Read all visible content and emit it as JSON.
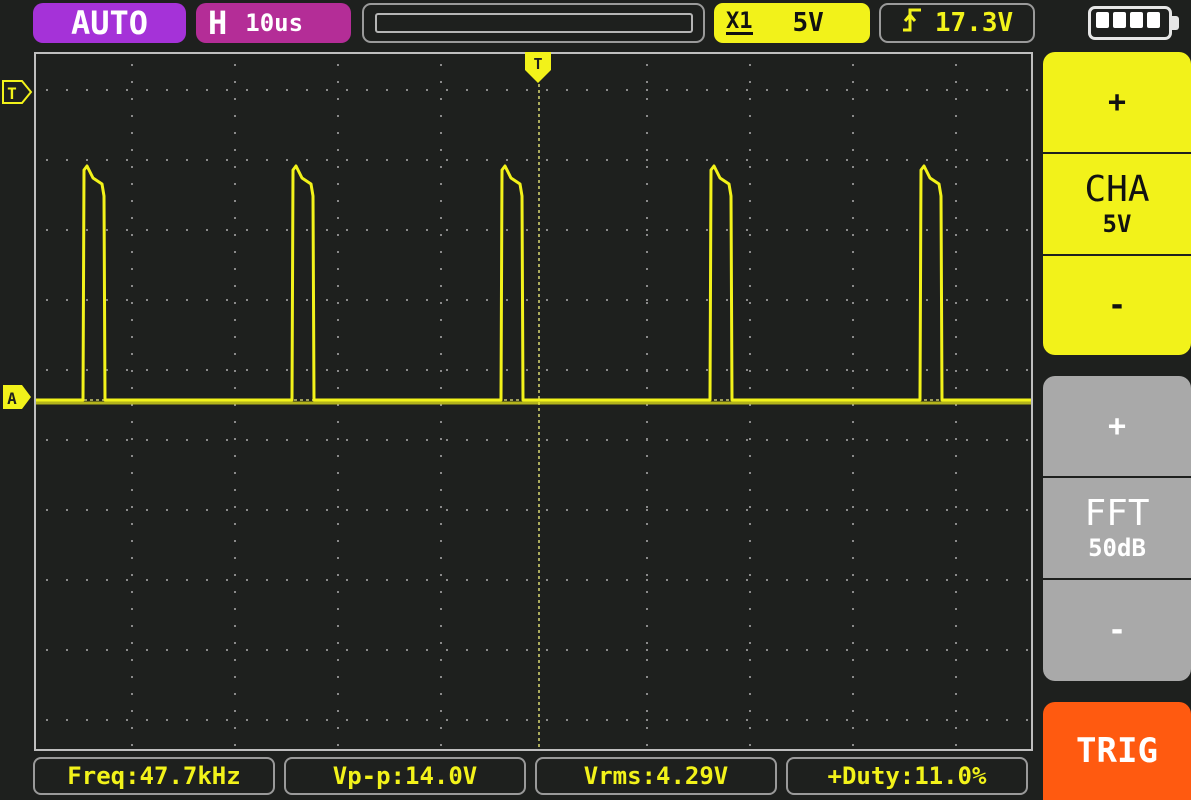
{
  "top_bar": {
    "mode": "AUTO",
    "timebase_prefix": "H",
    "timebase": "10us",
    "probe": "X1",
    "volts_div": "5V",
    "trigger_edge_icon": "rising-edge-icon",
    "trigger_level": "17.3V",
    "battery_bars": 4
  },
  "screen": {
    "trigger_marker_top": "T",
    "trigger_level_marker": "T",
    "channel_marker": "A",
    "trace_color": "#f2f21a",
    "grid_color": "#8a8a8a"
  },
  "cha_panel": {
    "plus": "+",
    "title": "CHA",
    "value": "5V",
    "minus": "-"
  },
  "fft_panel": {
    "plus": "+",
    "title": "FFT",
    "value": "50dB",
    "minus": "-"
  },
  "trig_button": "TRIG",
  "measurements": {
    "freq": "Freq:47.7kHz",
    "vpp": "Vp-p:14.0V",
    "vrms": "Vrms:4.29V",
    "duty": "+Duty:11.0%"
  },
  "colors": {
    "mode": "#a532d8",
    "timebase": "#b42d97",
    "channel": "#f2f21a",
    "trig": "#ff5a10",
    "fft": "#a9a9a9"
  }
}
